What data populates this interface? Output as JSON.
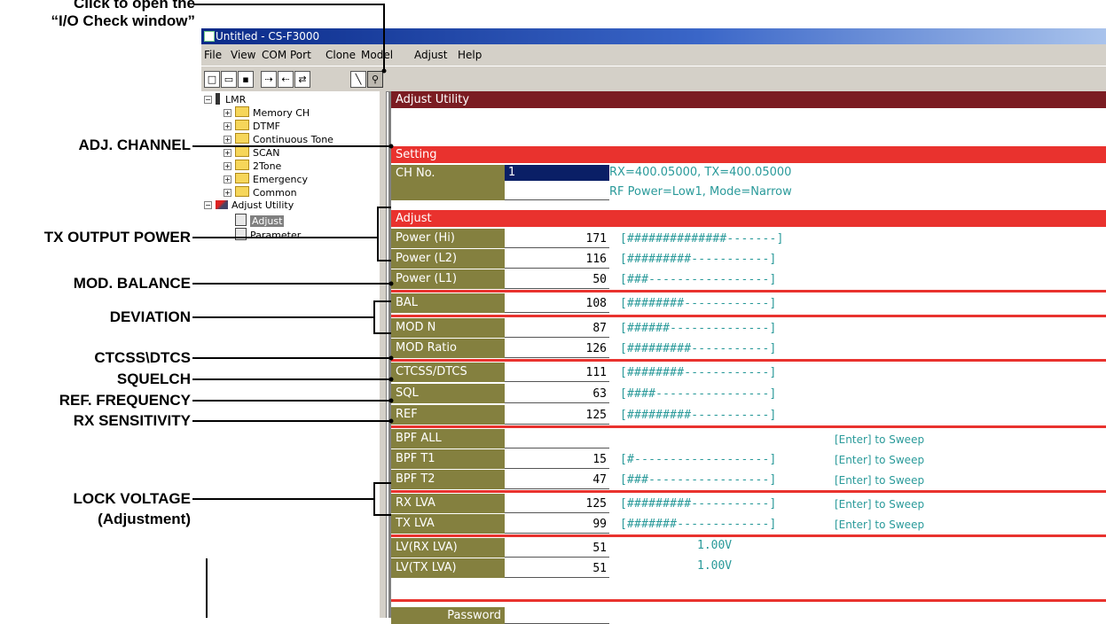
{
  "callouts": {
    "io_check_line1": "Click to open the",
    "io_check_line2": "“I/O Check window”",
    "adj_channel": "ADJ. CHANNEL",
    "tx_output_power": "TX OUTPUT POWER",
    "mod_balance": "MOD. BALANCE",
    "deviation": "DEVIATION",
    "ctcss_dtcs": "CTCSS\\DTCS",
    "squelch": "SQUELCH",
    "ref_frequency": "REF. FREQUENCY",
    "rx_sensitivity": "RX SENSITIVITY",
    "lock_voltage_line1": "LOCK VOLTAGE",
    "lock_voltage_line2": "(Adjustment)"
  },
  "window": {
    "title": "Untitled - CS-F3000"
  },
  "menu": [
    "File",
    "View",
    "COM Port",
    "Clone",
    "Model",
    "Adjust",
    "Help"
  ],
  "tree": {
    "root": "LMR",
    "items": [
      "Memory CH",
      "DTMF",
      "Continuous Tone",
      "SCAN",
      "2Tone",
      "Emergency",
      "Common"
    ],
    "adjust_utility": "Adjust Utility",
    "adjust": "Adjust",
    "parameter": "Parameter"
  },
  "panel": {
    "title": "Adjust Utility",
    "setting_header": "Setting",
    "adjust_header": "Adjust",
    "ch_label": "CH No.",
    "ch_value": "1",
    "ch_info1": "RX=400.05000, TX=400.05000",
    "ch_info2": "RF Power=Low1, Mode=Narrow",
    "sweep_label": "[Enter] to Sweep",
    "password_label": "Password",
    "rows": [
      {
        "label": "Power (Hi)",
        "value": "171",
        "bar": "[##############-------]",
        "sweep": ""
      },
      {
        "label": "Power (L2)",
        "value": "116",
        "bar": "[#########-----------]",
        "sweep": ""
      },
      {
        "label": "Power (L1)",
        "value": "50",
        "bar": "[###-----------------]",
        "sweep": ""
      },
      {
        "label": "BAL",
        "value": "108",
        "bar": "[########------------]",
        "sweep": ""
      },
      {
        "label": "MOD N",
        "value": "87",
        "bar": "[######--------------]",
        "sweep": ""
      },
      {
        "label": "MOD Ratio",
        "value": "126",
        "bar": "[#########-----------]",
        "sweep": ""
      },
      {
        "label": "CTCSS/DTCS",
        "value": "111",
        "bar": "[########------------]",
        "sweep": ""
      },
      {
        "label": "SQL",
        "value": "63",
        "bar": "[####----------------]",
        "sweep": ""
      },
      {
        "label": "REF",
        "value": "125",
        "bar": "[#########-----------]",
        "sweep": ""
      },
      {
        "label": "BPF ALL",
        "value": "",
        "bar": "",
        "sweep": "[Enter] to Sweep"
      },
      {
        "label": "BPF T1",
        "value": "15",
        "bar": "[#-------------------]",
        "sweep": "[Enter] to Sweep"
      },
      {
        "label": "BPF T2",
        "value": "47",
        "bar": "[###-----------------]",
        "sweep": "[Enter] to Sweep"
      },
      {
        "label": "RX LVA",
        "value": "125",
        "bar": "[#########-----------]",
        "sweep": "[Enter] to Sweep"
      },
      {
        "label": "TX LVA",
        "value": "99",
        "bar": "[#######-------------]",
        "sweep": "[Enter] to Sweep"
      },
      {
        "label": "LV(RX LVA)",
        "value": "51",
        "voltage": "1.00V"
      },
      {
        "label": "LV(TX LVA)",
        "value": "51",
        "voltage": "1.00V"
      }
    ]
  }
}
